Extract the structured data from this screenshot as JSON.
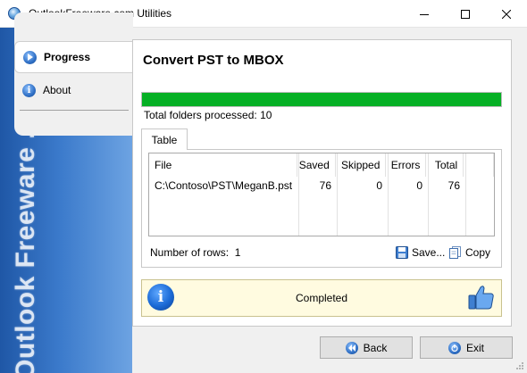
{
  "window": {
    "title": "OutlookFreeware.com Utilities"
  },
  "sidebar": {
    "watermark": "Outlook Freeware .com",
    "items": [
      {
        "label": "Progress",
        "icon": "play-icon",
        "active": true
      },
      {
        "label": "About",
        "icon": "info-icon",
        "active": false
      }
    ]
  },
  "main": {
    "heading": "Convert PST to MBOX",
    "progress": {
      "value": 1.0,
      "color": "#06b025"
    },
    "folders_processed": "Total folders processed: 10",
    "tab_label": "Table",
    "table": {
      "columns": [
        "File",
        "Saved",
        "Skipped",
        "Errors",
        "Total"
      ],
      "rows": [
        [
          "C:\\Contoso\\PST\\MeganB.pst",
          "76",
          "0",
          "0",
          "76"
        ]
      ]
    },
    "rows_label": "Number of rows:",
    "rows_value": "1",
    "save_label": "Save...",
    "copy_label": "Copy",
    "status_text": "Completed"
  },
  "footer": {
    "back_label": "Back",
    "exit_label": "Exit"
  },
  "colors": {
    "accent": "#1f57a6",
    "progress": "#06b025",
    "status_bg": "#fffbe0"
  }
}
